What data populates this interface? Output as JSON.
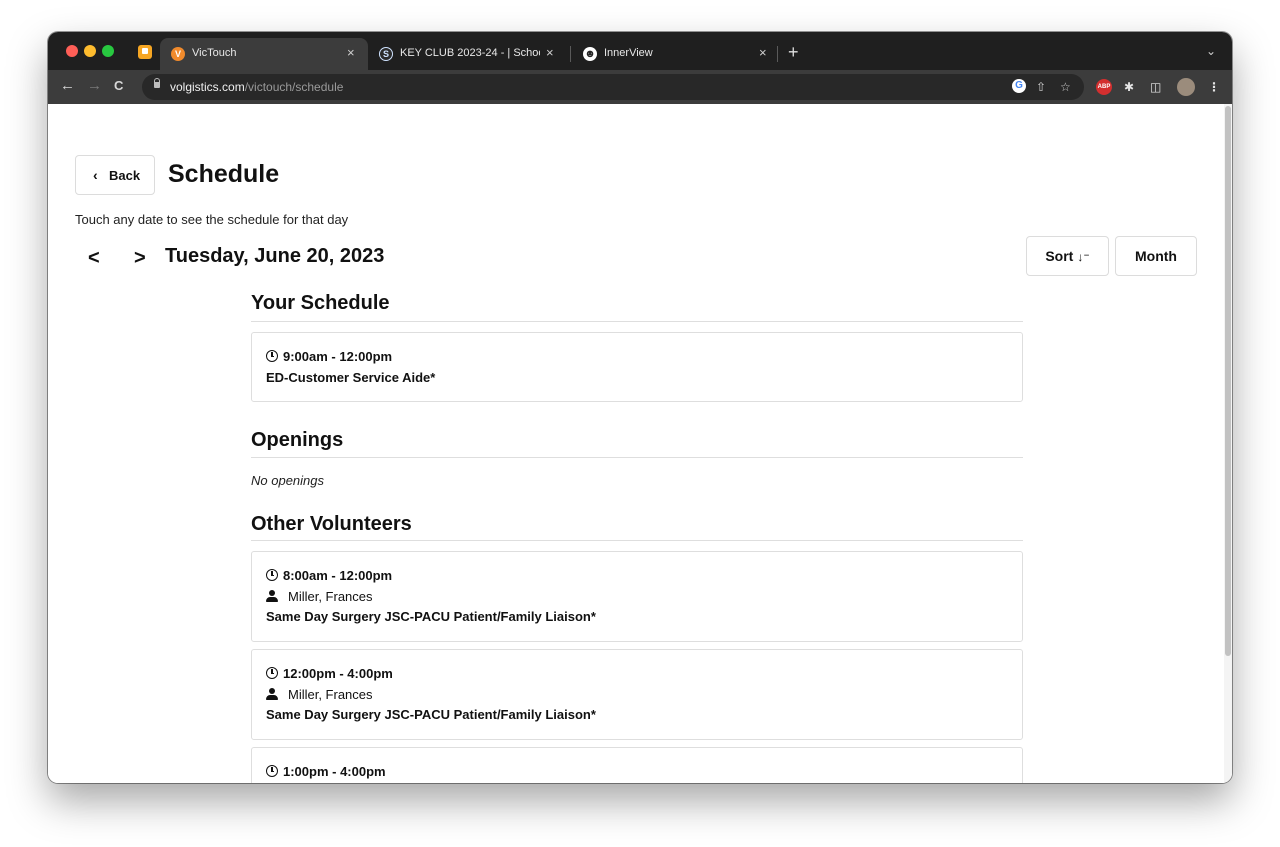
{
  "browser": {
    "tabs": [
      {
        "title": "VicTouch",
        "favicon": "V",
        "active": true
      },
      {
        "title": "KEY CLUB 2023-24 - | Schoolo",
        "favicon": "S",
        "active": false
      },
      {
        "title": "InnerView",
        "favicon": "☻",
        "active": false
      }
    ],
    "close_glyph": "×",
    "new_tab_glyph": "+",
    "url_host": "volgistics.com",
    "url_path": "/victouch/schedule",
    "nav": {
      "back": "←",
      "forward": "→",
      "reload": "C"
    }
  },
  "page": {
    "back_label": "Back",
    "title": "Schedule",
    "hint": "Touch any date to see the schedule for that day",
    "date": "Tuesday, June 20, 2023",
    "sort_label": "Sort",
    "month_label": "Month",
    "your_schedule": {
      "heading": "Your Schedule",
      "items": [
        {
          "time": "9:00am - 12:00pm",
          "role": "ED-Customer Service Aide*"
        }
      ]
    },
    "openings": {
      "heading": "Openings",
      "empty_text": "No openings"
    },
    "other_volunteers": {
      "heading": "Other Volunteers",
      "items": [
        {
          "time": "8:00am - 12:00pm",
          "person": "Miller, Frances",
          "role": "Same Day Surgery JSC-PACU Patient/Family Liaison*"
        },
        {
          "time": "12:00pm - 4:00pm",
          "person": "Miller, Frances",
          "role": "Same Day Surgery JSC-PACU Patient/Family Liaison*"
        },
        {
          "time": "1:00pm - 4:00pm"
        }
      ]
    }
  }
}
